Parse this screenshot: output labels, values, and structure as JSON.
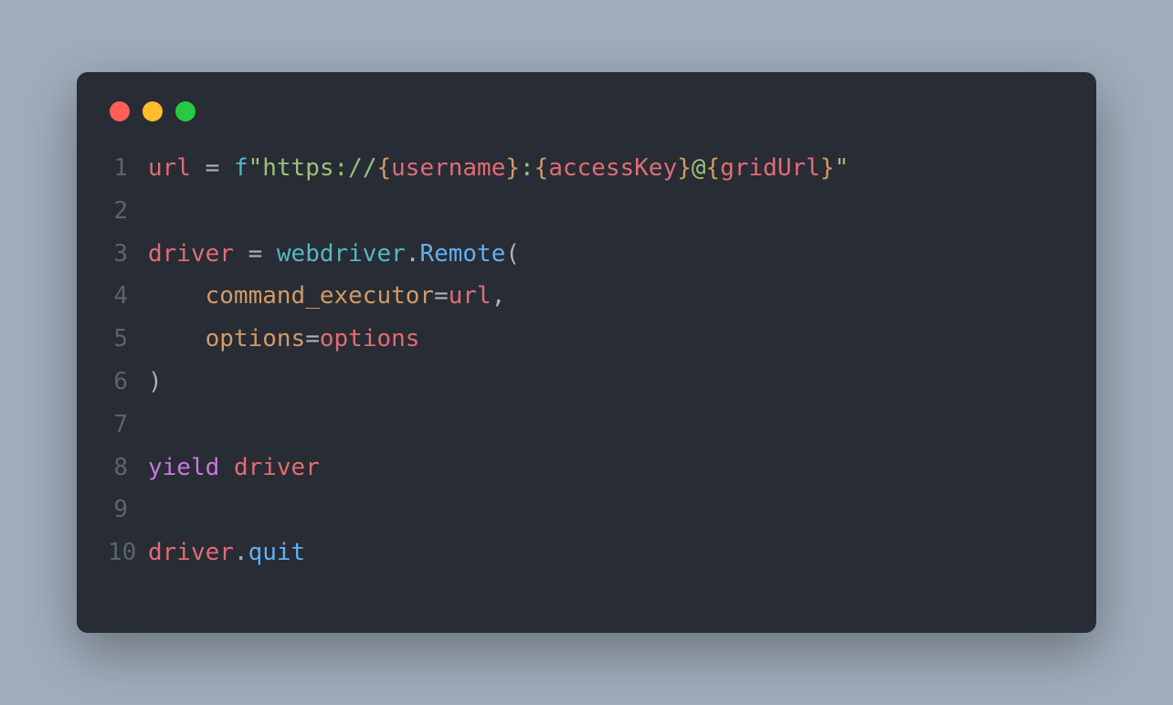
{
  "lines": [
    {
      "num": "1",
      "tokens": [
        {
          "t": "url",
          "c": "tok-red"
        },
        {
          "t": " ",
          "c": "tok-default"
        },
        {
          "t": "=",
          "c": "tok-operator"
        },
        {
          "t": " ",
          "c": "tok-default"
        },
        {
          "t": "f",
          "c": "tok-cyan"
        },
        {
          "t": "\"https://",
          "c": "tok-green"
        },
        {
          "t": "{",
          "c": "tok-orange"
        },
        {
          "t": "username",
          "c": "tok-red"
        },
        {
          "t": "}",
          "c": "tok-orange"
        },
        {
          "t": ":",
          "c": "tok-green"
        },
        {
          "t": "{",
          "c": "tok-orange"
        },
        {
          "t": "accessKey",
          "c": "tok-red"
        },
        {
          "t": "}",
          "c": "tok-orange"
        },
        {
          "t": "@",
          "c": "tok-green"
        },
        {
          "t": "{",
          "c": "tok-orange"
        },
        {
          "t": "gridUrl",
          "c": "tok-red"
        },
        {
          "t": "}",
          "c": "tok-orange"
        },
        {
          "t": "\"",
          "c": "tok-green"
        }
      ]
    },
    {
      "num": "2",
      "tokens": []
    },
    {
      "num": "3",
      "tokens": [
        {
          "t": "driver",
          "c": "tok-red"
        },
        {
          "t": " ",
          "c": "tok-default"
        },
        {
          "t": "=",
          "c": "tok-operator"
        },
        {
          "t": " ",
          "c": "tok-default"
        },
        {
          "t": "webdriver",
          "c": "tok-cyan"
        },
        {
          "t": ".",
          "c": "tok-default"
        },
        {
          "t": "Remote",
          "c": "tok-fn"
        },
        {
          "t": "(",
          "c": "tok-brace"
        }
      ]
    },
    {
      "num": "4",
      "tokens": [
        {
          "t": "    ",
          "c": "tok-default"
        },
        {
          "t": "command_executor",
          "c": "tok-orange"
        },
        {
          "t": "=",
          "c": "tok-operator"
        },
        {
          "t": "url",
          "c": "tok-red"
        },
        {
          "t": ",",
          "c": "tok-default"
        }
      ]
    },
    {
      "num": "5",
      "tokens": [
        {
          "t": "    ",
          "c": "tok-default"
        },
        {
          "t": "options",
          "c": "tok-orange"
        },
        {
          "t": "=",
          "c": "tok-operator"
        },
        {
          "t": "options",
          "c": "tok-red"
        }
      ]
    },
    {
      "num": "6",
      "tokens": [
        {
          "t": ")",
          "c": "tok-brace"
        }
      ]
    },
    {
      "num": "7",
      "tokens": []
    },
    {
      "num": "8",
      "tokens": [
        {
          "t": "yield",
          "c": "tok-purple"
        },
        {
          "t": " ",
          "c": "tok-default"
        },
        {
          "t": "driver",
          "c": "tok-red"
        }
      ]
    },
    {
      "num": "9",
      "tokens": []
    },
    {
      "num": "10",
      "tokens": [
        {
          "t": "driver",
          "c": "tok-red"
        },
        {
          "t": ".",
          "c": "tok-default"
        },
        {
          "t": "quit",
          "c": "tok-fn"
        }
      ]
    }
  ]
}
